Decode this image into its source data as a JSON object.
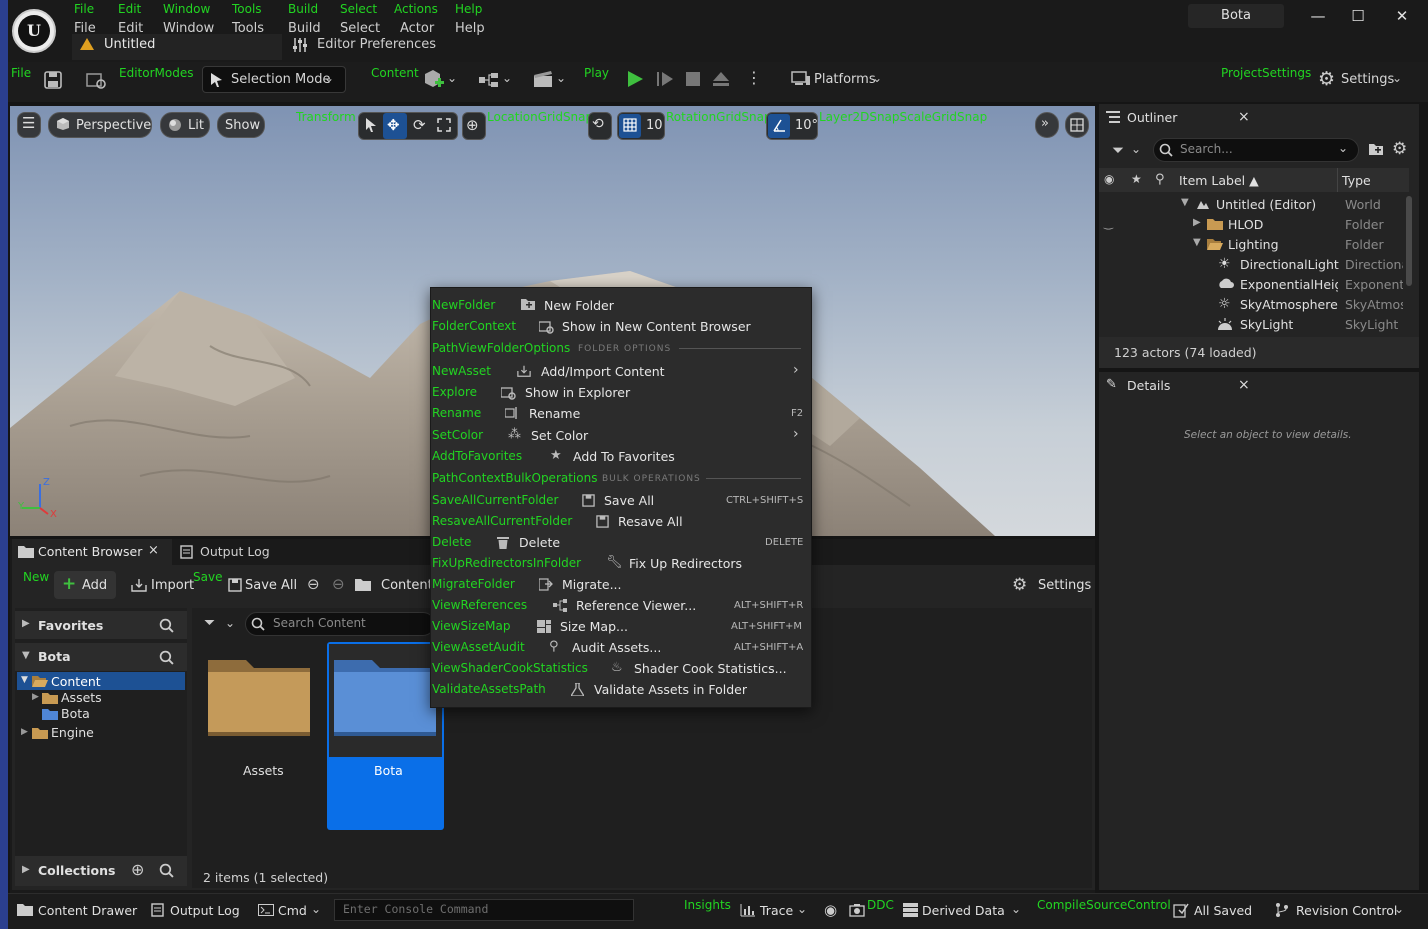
{
  "window": {
    "project_name": "Bota",
    "document_tab": "Untitled",
    "minimize": "—",
    "maximize": "☐",
    "close": "✕"
  },
  "menu_debug": [
    "File",
    "Edit",
    "Window",
    "Tools",
    "Build",
    "Select",
    "Actions",
    "Help"
  ],
  "menu_bar": [
    "File",
    "Edit",
    "Window",
    "Tools",
    "Build",
    "Select",
    "Actor",
    "Help"
  ],
  "editor_preferences": "Editor Preferences",
  "toolbar": {
    "file_debug": "File",
    "editor_modes_debug": "EditorModes",
    "selection_mode": "Selection Mode",
    "content_debug": "Content",
    "play_debug": "Play",
    "platforms": "Platforms",
    "project_settings_debug": "ProjectSettings",
    "settings": "Settings"
  },
  "viewport": {
    "perspective": "Perspective",
    "lit": "Lit",
    "show": "Show",
    "transform_debug": "Transform",
    "location_grid_snap_debug": "LocationGridSnap",
    "rotation_grid_snap_debug": "RotationGridSnap",
    "layer_snap_debug": "Layer2DSnapScaleGridSnap",
    "grid_value": "10",
    "rotation_value": "10°",
    "axis_z": "Z",
    "axis_y": "Y",
    "axis_x": "X"
  },
  "outliner": {
    "title": "Outliner",
    "close": "×",
    "search_placeholder": "Search...",
    "col_label": "Item Label ▲",
    "col_type": "Type",
    "rows": [
      {
        "label": "Untitled (Editor)",
        "type": "World"
      },
      {
        "label": "HLOD",
        "type": "Folder"
      },
      {
        "label": "Lighting",
        "type": "Folder"
      },
      {
        "label": "DirectionalLight",
        "type": "Directiona"
      },
      {
        "label": "ExponentialHeigh",
        "type": "Exponenti"
      },
      {
        "label": "SkyAtmosphere",
        "type": "SkyAtmos"
      },
      {
        "label": "SkyLight",
        "type": "SkyLight"
      }
    ],
    "footer": "123 actors (74 loaded)"
  },
  "details": {
    "title": "Details",
    "close": "×",
    "empty_message": "Select an object to view details."
  },
  "content_browser": {
    "tab_content": "Content Browser",
    "tab_close": "×",
    "tab_output": "Output Log",
    "new_debug": "New",
    "add": "Add",
    "import": "Import",
    "save_debug": "Save",
    "save_all": "Save All",
    "breadcrumb": "Content",
    "settings": "Settings",
    "favorites": "Favorites",
    "project_root": "Bota",
    "tree": [
      {
        "label": "Content"
      },
      {
        "label": "Assets"
      },
      {
        "label": "Bota"
      },
      {
        "label": "Engine"
      }
    ],
    "collections": "Collections",
    "search_placeholder": "Search Content",
    "assets": [
      {
        "label": "Assets"
      },
      {
        "label": "Bota"
      }
    ],
    "status": "2 items (1 selected)"
  },
  "context_menu": {
    "items": [
      {
        "debug": "NewFolder",
        "label": "New Folder",
        "shortcut": ""
      },
      {
        "debug": "FolderContext",
        "label": "Show in New Content Browser",
        "shortcut": ""
      },
      {
        "debug": "PathViewFolderOptions",
        "section": "FOLDER OPTIONS"
      },
      {
        "debug": "NewAsset",
        "label": "Add/Import Content",
        "shortcut": ""
      },
      {
        "debug": "Explore",
        "label": "Show in Explorer",
        "shortcut": ""
      },
      {
        "debug": "Rename",
        "label": "Rename",
        "shortcut": "F2"
      },
      {
        "debug": "SetColor",
        "label": "Set Color",
        "shortcut": ""
      },
      {
        "debug": "AddToFavorites",
        "label": "Add To Favorites",
        "shortcut": ""
      },
      {
        "debug": "PathContextBulkOperations",
        "section": "BULK OPERATIONS"
      },
      {
        "debug": "SaveAllCurrentFolder",
        "label": "Save All",
        "shortcut": "CTRL+SHIFT+S"
      },
      {
        "debug": "ResaveAllCurrentFolder",
        "label": "Resave All",
        "shortcut": ""
      },
      {
        "debug": "Delete",
        "label": "Delete",
        "shortcut": "DELETE"
      },
      {
        "debug": "FixUpRedirectorsInFolder",
        "label": "Fix Up Redirectors",
        "shortcut": ""
      },
      {
        "debug": "MigrateFolder",
        "label": "Migrate...",
        "shortcut": ""
      },
      {
        "debug": "ViewReferences",
        "label": "Reference Viewer...",
        "shortcut": "ALT+SHIFT+R"
      },
      {
        "debug": "ViewSizeMap",
        "label": "Size Map...",
        "shortcut": "ALT+SHIFT+M"
      },
      {
        "debug": "ViewAssetAudit",
        "label": "Audit Assets...",
        "shortcut": "ALT+SHIFT+A"
      },
      {
        "debug": "ViewShaderCookStatistics",
        "label": "Shader Cook Statistics...",
        "shortcut": ""
      },
      {
        "debug": "ValidateAssetsPath",
        "label": "Validate Assets in Folder",
        "shortcut": ""
      }
    ]
  },
  "status_bar": {
    "content_drawer": "Content Drawer",
    "output_log": "Output Log",
    "cmd": "Cmd",
    "console_placeholder": "Enter Console Command",
    "insights_debug": "Insights",
    "trace": "Trace",
    "ddc_debug": "DDC",
    "derived_data": "Derived Data",
    "compile_debug": "CompileSourceControl",
    "all_saved": "All Saved",
    "revision_control": "Revision Control"
  },
  "colors": {
    "debug_green": "#22d422",
    "selection_blue": "#1d5194",
    "asset_selected": "#0a6fe8",
    "play_green": "#3fbf3f"
  }
}
